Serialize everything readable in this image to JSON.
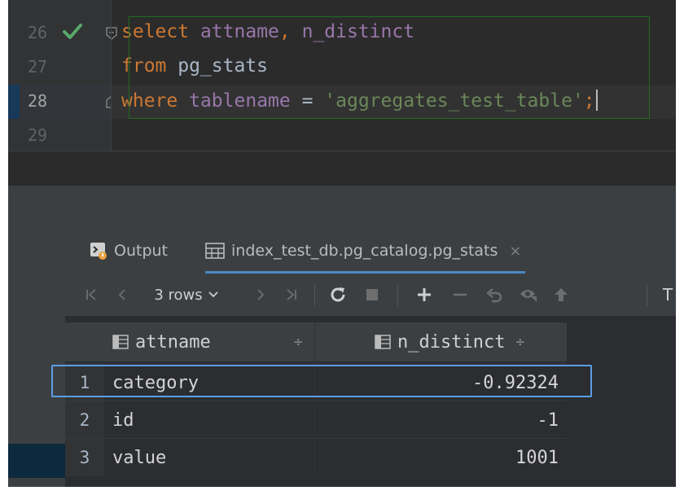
{
  "editor": {
    "lines": [
      {
        "number": "26",
        "tokens": [
          {
            "t": "select",
            "c": "kw"
          },
          {
            "t": " ",
            "c": ""
          },
          {
            "t": "attname",
            "c": "col"
          },
          {
            "t": ", ",
            "c": "kw"
          },
          {
            "t": "n_distinct",
            "c": "col"
          }
        ]
      },
      {
        "number": "27",
        "tokens": [
          {
            "t": "from",
            "c": "kw"
          },
          {
            "t": " pg_stats",
            "c": ""
          }
        ]
      },
      {
        "number": "28",
        "tokens": [
          {
            "t": "where",
            "c": "kw"
          },
          {
            "t": " ",
            "c": ""
          },
          {
            "t": "tablename",
            "c": "col"
          },
          {
            "t": " = ",
            "c": ""
          },
          {
            "t": "'aggregates_test_table'",
            "c": "str"
          },
          {
            "t": ";",
            "c": "kw"
          }
        ]
      },
      {
        "number": "29",
        "tokens": []
      }
    ],
    "colors": {
      "keyword": "#cc7832",
      "column": "#9876aa",
      "string": "#6a8759",
      "statement_border": "#216b21"
    }
  },
  "tabs": [
    {
      "label": "Output",
      "icon": "output-console-icon"
    },
    {
      "label": "index_test_db.pg_catalog.pg_stats",
      "icon": "table-grid-icon",
      "close": "×"
    }
  ],
  "toolbar": {
    "rows_label": "3 rows",
    "truncated_label": "T"
  },
  "grid": {
    "columns": [
      "attname",
      "n_distinct"
    ],
    "sort_glyph": "÷",
    "rows": [
      {
        "n": "1",
        "attname": "category",
        "n_distinct": "-0.92324"
      },
      {
        "n": "2",
        "attname": "id",
        "n_distinct": "-1"
      },
      {
        "n": "3",
        "attname": "value",
        "n_distinct": "1001"
      }
    ]
  },
  "colors": {
    "selection": "#5b9ee6",
    "tab_underline": "#4a88c7",
    "check": "#59a869"
  }
}
